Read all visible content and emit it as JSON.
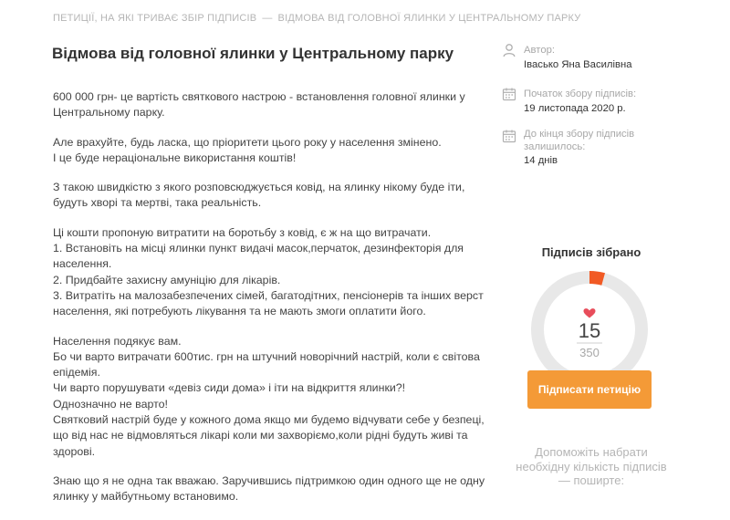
{
  "breadcrumb": {
    "parent": "ПЕТИЦІЇ, НА ЯКІ ТРИВАЄ ЗБІР ПІДПИСІВ",
    "separator": "—",
    "current": "ВІДМОВА ВІД ГОЛОВНОЇ ЯЛИНКИ У ЦЕНТРАЛЬНОМУ ПАРКУ"
  },
  "title": "Відмова від головної ялинки у Центральному парку",
  "body_paragraphs": [
    [
      "600 000 грн- це вартість святкового настрою - встановлення головної ялинки у",
      "Центральному парку."
    ],
    [
      "Але врахуйте, будь ласка, що пріоритети цього року у населення змінено.",
      "І це буде нераціональне використання коштів!"
    ],
    [
      "З такою швидкістю з якого розповсюджується ковід, на ялинку нікому буде іти,",
      "будуть хворі та мертві, така реальність."
    ],
    [
      "Ці кошти пропоную витратити на боротьбу з ковід, є ж на що витрачати.",
      "1. Встановіть на місці ялинки пункт видачі масок,перчаток, дезинфекторія для",
      "населення.",
      "2. Придбайте захисну амуніцію для лікарів.",
      "3. Витратіть на малозабезпечених сімей, багатодітних, пенсіонерів та інших верст",
      "населення, які потребують лікування та не мають змоги оплатити його."
    ],
    [
      "Населення подякує вам.",
      "Бо чи варто витрачати 600тис. грн на штучний новорічний настрій, коли є світова",
      "епідемія.",
      "Чи варто порушувати «девіз сиди дома» і іти на відкриття ялинки?!",
      "Однозначно не варто!",
      "Святковий настрій буде у кожного дома якщо ми будемо відчувати себе у безпеці,",
      "що від нас не відмовляться лікарі коли ми захворіємо,коли рідні будуть живі та",
      "здорові."
    ],
    [
      "Знаю що я не одна так вважаю. Заручившись підтримкою один одного ще не одну",
      "ялинку у майбутньому встановимо."
    ]
  ],
  "sidebar": {
    "author_label": "Автор:",
    "author_name": "Івасько Яна Василівна",
    "start_label": "Початок збору підписів:",
    "start_date": "19 листопада 2020 р.",
    "remaining_label_1": "До кінця збору підписів",
    "remaining_label_2": "залишилось:",
    "remaining_value": "14 днів",
    "icons": {
      "author": "user-icon",
      "start": "calendar-icon",
      "remaining": "calendar-icon"
    }
  },
  "signatures": {
    "title": "Підписів зібрано",
    "collected": 15,
    "goal": 350,
    "collected_text": "15",
    "goal_text": "350",
    "heart_icon": "heart-icon"
  },
  "sign_button_label": "Підписати петицію",
  "share_text": "Допоможіть набрати необхідну кількість підписів — поширте:",
  "colors": {
    "accent": "#f49a37",
    "progress": "#f15a24",
    "ring": "#e8e8e8",
    "heart": "#e84d5b",
    "muted": "#b5b5b5"
  }
}
